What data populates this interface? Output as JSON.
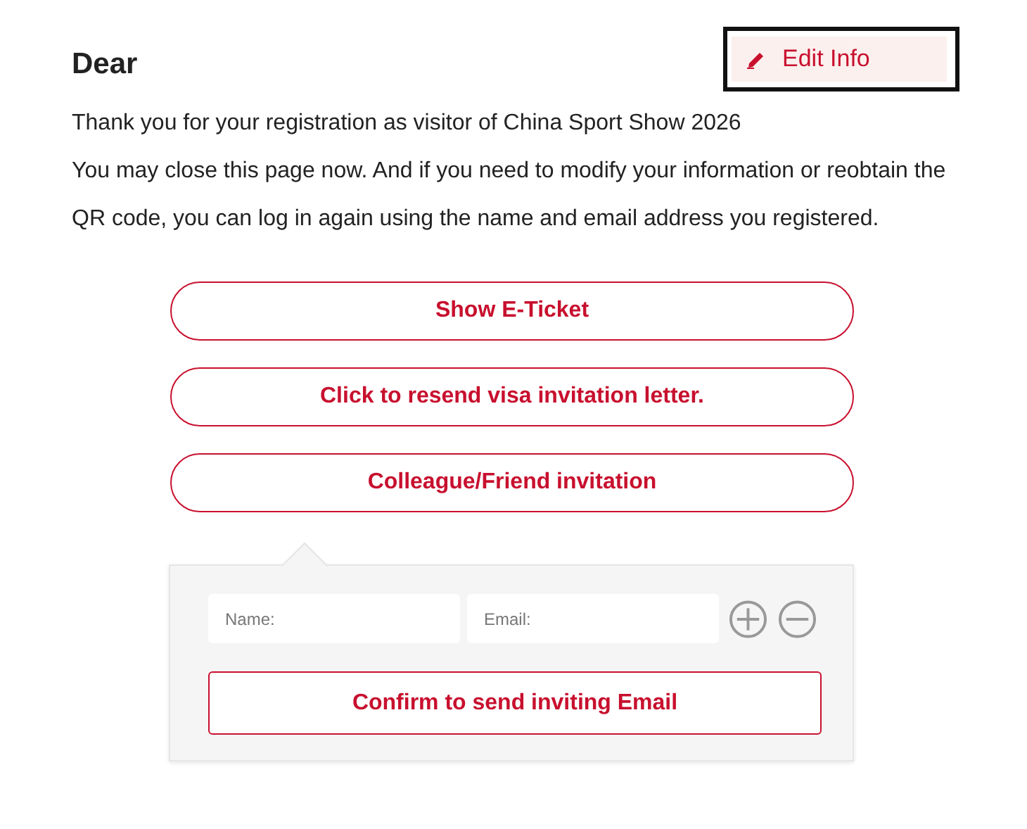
{
  "heading": "Dear",
  "edit_button": {
    "label": "Edit Info",
    "focused": true
  },
  "paragraphs": [
    "Thank you for your registration as visitor of China Sport Show 2026",
    "You may close this page now. And if you need to modify your information or reobtain the QR code, you can log in again using the name and email address you registered."
  ],
  "action_buttons": [
    "Show E-Ticket",
    "Click to resend visa invitation letter.",
    "Colleague/Friend invitation"
  ],
  "invite_panel": {
    "expanded": true,
    "fields": [
      {
        "placeholder": "Name:"
      },
      {
        "placeholder": "Email:"
      }
    ],
    "confirm_button": "Confirm to send inviting Email"
  }
}
